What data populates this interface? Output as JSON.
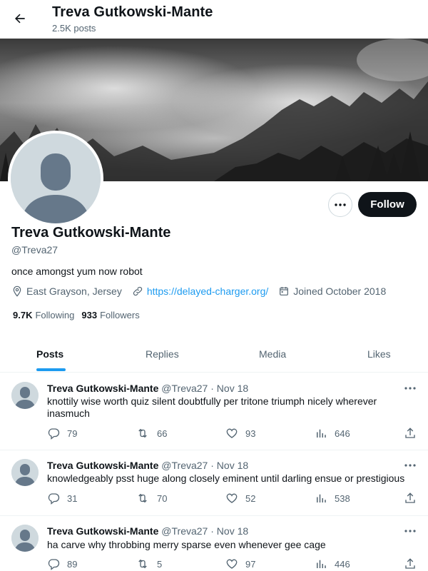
{
  "header": {
    "title": "Treva Gutkowski-Mante",
    "subtitle": "2.5K posts"
  },
  "profile": {
    "name": "Treva Gutkowski-Mante",
    "handle": "@Treva27",
    "bio": "once amongst yum now robot",
    "location": "East Grayson, Jersey",
    "website": "https://delayed-charger.org/",
    "joined": "Joined October 2018",
    "following_count": "9.7K",
    "following_label": "Following",
    "followers_count": "933",
    "followers_label": "Followers",
    "follow_button": "Follow",
    "more_button": "•••"
  },
  "tabs": [
    {
      "label": "Posts",
      "active": true
    },
    {
      "label": "Replies",
      "active": false
    },
    {
      "label": "Media",
      "active": false
    },
    {
      "label": "Likes",
      "active": false
    }
  ],
  "posts": [
    {
      "name": "Treva Gutkowski-Mante",
      "handle": "@Treva27",
      "separator": "·",
      "date": "Nov 18",
      "text": "knottily wise worth quiz silent doubtfully per tritone triumph nicely wherever inasmuch",
      "replies": "79",
      "reposts": "66",
      "likes": "93",
      "views": "646"
    },
    {
      "name": "Treva Gutkowski-Mante",
      "handle": "@Treva27",
      "separator": "·",
      "date": "Nov 18",
      "text": "knowledgeably psst huge along closely eminent until darling ensue or prestigious",
      "replies": "31",
      "reposts": "70",
      "likes": "52",
      "views": "538"
    },
    {
      "name": "Treva Gutkowski-Mante",
      "handle": "@Treva27",
      "separator": "·",
      "date": "Nov 18",
      "text": "ha carve why throbbing merry sparse even whenever gee cage",
      "replies": "89",
      "reposts": "5",
      "likes": "97",
      "views": "446"
    }
  ],
  "icons": {
    "back": "arrow-left-icon",
    "more": "ellipsis-icon",
    "location": "map-pin-icon",
    "link": "link-icon",
    "calendar": "calendar-icon",
    "reply": "reply-icon",
    "repost": "repost-icon",
    "like": "heart-icon",
    "views": "analytics-icon",
    "share": "share-icon"
  },
  "colors": {
    "accent": "#1d9bf0",
    "text": "#0f1419",
    "muted": "#536471",
    "follow_bg": "#0f1419"
  }
}
